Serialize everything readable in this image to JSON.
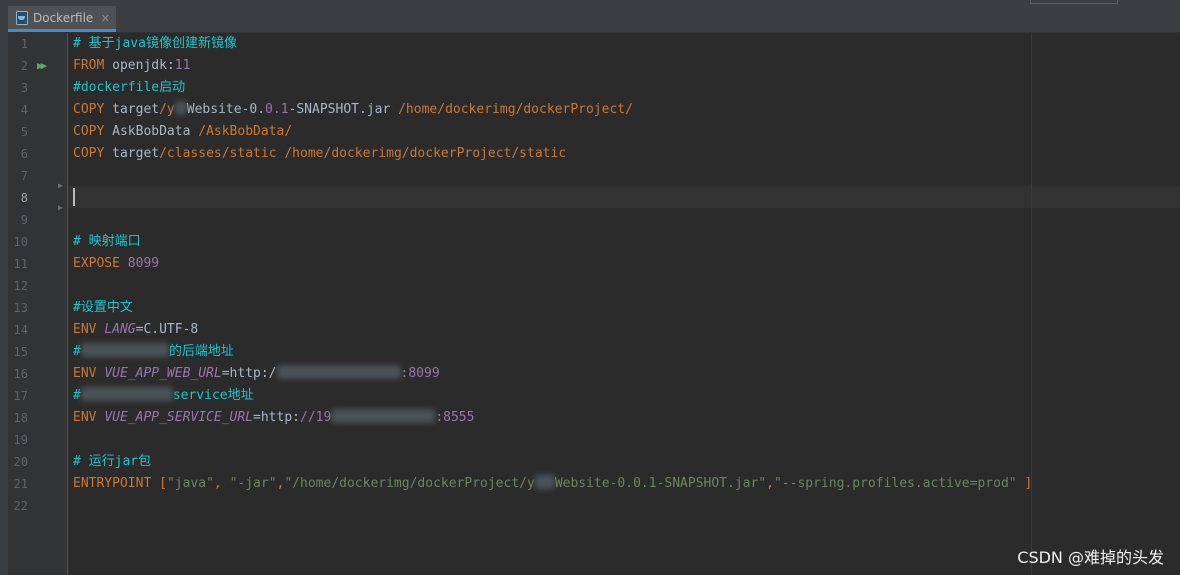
{
  "tab": {
    "title": "Dockerfile",
    "close_glyph": "×"
  },
  "line_numbers": [
    "1",
    "2",
    "3",
    "4",
    "5",
    "6",
    "7",
    "8",
    "9",
    "10",
    "11",
    "12",
    "13",
    "14",
    "15",
    "16",
    "17",
    "18",
    "19",
    "20",
    "21",
    "22"
  ],
  "code": {
    "l1": {
      "text": "# 基于java镜像创建新镜像"
    },
    "l2": {
      "kw": "FROM",
      "image": "openjdk",
      "sep": ":",
      "tag": "11"
    },
    "l3": {
      "text": "#dockerfile启动"
    },
    "l4": {
      "kw": "COPY",
      "p1": "target",
      "p2": "/y",
      "p3": "Website-0",
      "p4": ".",
      "p5": "0.1",
      "p6": "-SNAPSHOT.jar",
      "p7": "/home",
      "p8": "/dockerimg",
      "p9": "/dockerProject/"
    },
    "l5": {
      "kw": "COPY",
      "src": "AskBobData",
      "dst": "/AskBobData/"
    },
    "l6": {
      "kw": "COPY",
      "p1": "target",
      "p2": "/classes",
      "p3": "/static",
      "p4": "/home",
      "p5": "/dockerimg",
      "p6": "/dockerProject",
      "p7": "/static"
    },
    "l10": {
      "text": "# 映射端口"
    },
    "l11": {
      "kw": "EXPOSE",
      "port": "8099"
    },
    "l13": {
      "text": "#设置中文"
    },
    "l14": {
      "kw": "ENV",
      "name": "LANG",
      "value": "=C.UTF-8"
    },
    "l15": {
      "hash": "#",
      "text": "的后端地址"
    },
    "l16": {
      "kw": "ENV",
      "name": "VUE_APP_WEB_URL",
      "value": "=http:/",
      "port": ":8099"
    },
    "l17": {
      "hash": "#",
      "text": "service地址"
    },
    "l18": {
      "kw": "ENV",
      "name": "VUE_APP_SERVICE_URL",
      "value": "=http:",
      "ip": "//19",
      "port": ":8555"
    },
    "l20": {
      "text": "# 运行jar包"
    },
    "l21": {
      "kw": "ENTRYPOINT",
      "open": "[",
      "a1": "\"java\"",
      "c1": ", ",
      "a2": "\"-jar\"",
      "c2": ",",
      "a3a": "\"/home/dockerimg/dockerProject/y",
      "a3b": "Website-0.0.1-SNAPSHOT.jar\"",
      "c3": ",",
      "a4": "\"--spring.profiles.active=prod\"",
      "close": "]"
    }
  },
  "watermark": "CSDN @难掉的头发"
}
